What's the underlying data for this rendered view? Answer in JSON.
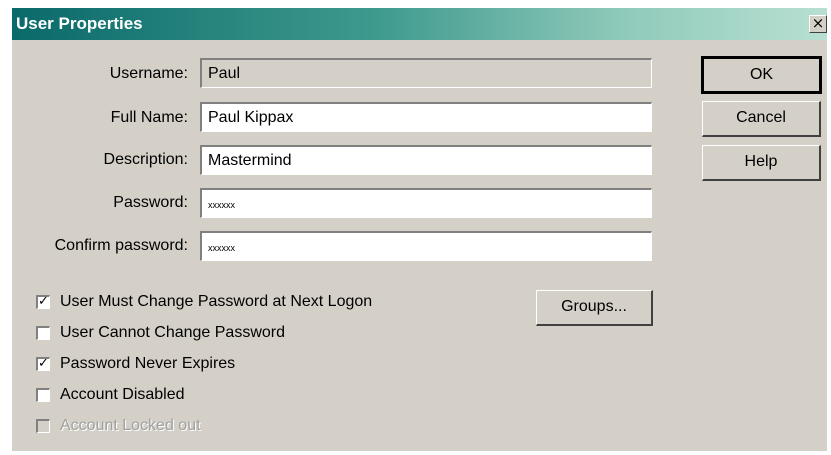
{
  "window": {
    "title": "User Properties",
    "close_glyph": "×"
  },
  "form": {
    "username": {
      "label": "Username:",
      "value": "Paul",
      "readonly": true
    },
    "full_name": {
      "label": "Full Name:",
      "value": "Paul Kippax"
    },
    "description": {
      "label": "Description:",
      "value": "Mastermind"
    },
    "password": {
      "label": "Password:",
      "value": "xxxxxx"
    },
    "confirm_password": {
      "label": "Confirm password:",
      "value": "xxxxxx"
    }
  },
  "buttons": {
    "ok": "OK",
    "cancel": "Cancel",
    "help": "Help",
    "groups": "Groups..."
  },
  "checkboxes": [
    {
      "label": "User Must Change Password at Next Logon",
      "checked": true,
      "enabled": true
    },
    {
      "label": "User Cannot Change Password",
      "checked": false,
      "enabled": true
    },
    {
      "label": "Password Never Expires",
      "checked": true,
      "enabled": true
    },
    {
      "label": "Account Disabled",
      "checked": false,
      "enabled": true
    },
    {
      "label": "Account Locked out",
      "checked": false,
      "enabled": false
    }
  ],
  "check_glyph": "✓",
  "colors": {
    "face": "#d4d0c8",
    "title_start": "#0a6a6a",
    "title_end": "#b8e0d2"
  }
}
